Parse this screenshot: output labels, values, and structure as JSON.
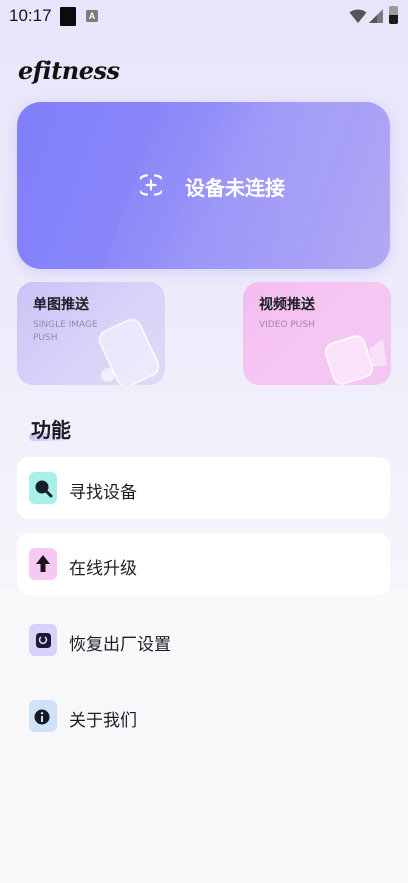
{
  "status_bar": {
    "time": "10:17",
    "notification_letter": "A"
  },
  "app": {
    "title": "efitness"
  },
  "device_card": {
    "label": "设备未连接"
  },
  "push_cards": [
    {
      "title": "单图推送",
      "subtitle": "SINGLE IMAGE PUSH"
    },
    {
      "title": "视频推送",
      "subtitle": "VIDEO PUSH"
    }
  ],
  "functions": {
    "section_title": "功能",
    "items": [
      {
        "label": "寻找设备",
        "icon": "search-device-icon",
        "color": "#4ee4d4"
      },
      {
        "label": "在线升级",
        "icon": "upgrade-icon",
        "color": "#f29ce8"
      },
      {
        "label": "恢复出厂设置",
        "icon": "factory-reset-icon",
        "color": "#b9adf5"
      },
      {
        "label": "关于我们",
        "icon": "about-icon",
        "color": "#a9cdf6"
      }
    ]
  }
}
